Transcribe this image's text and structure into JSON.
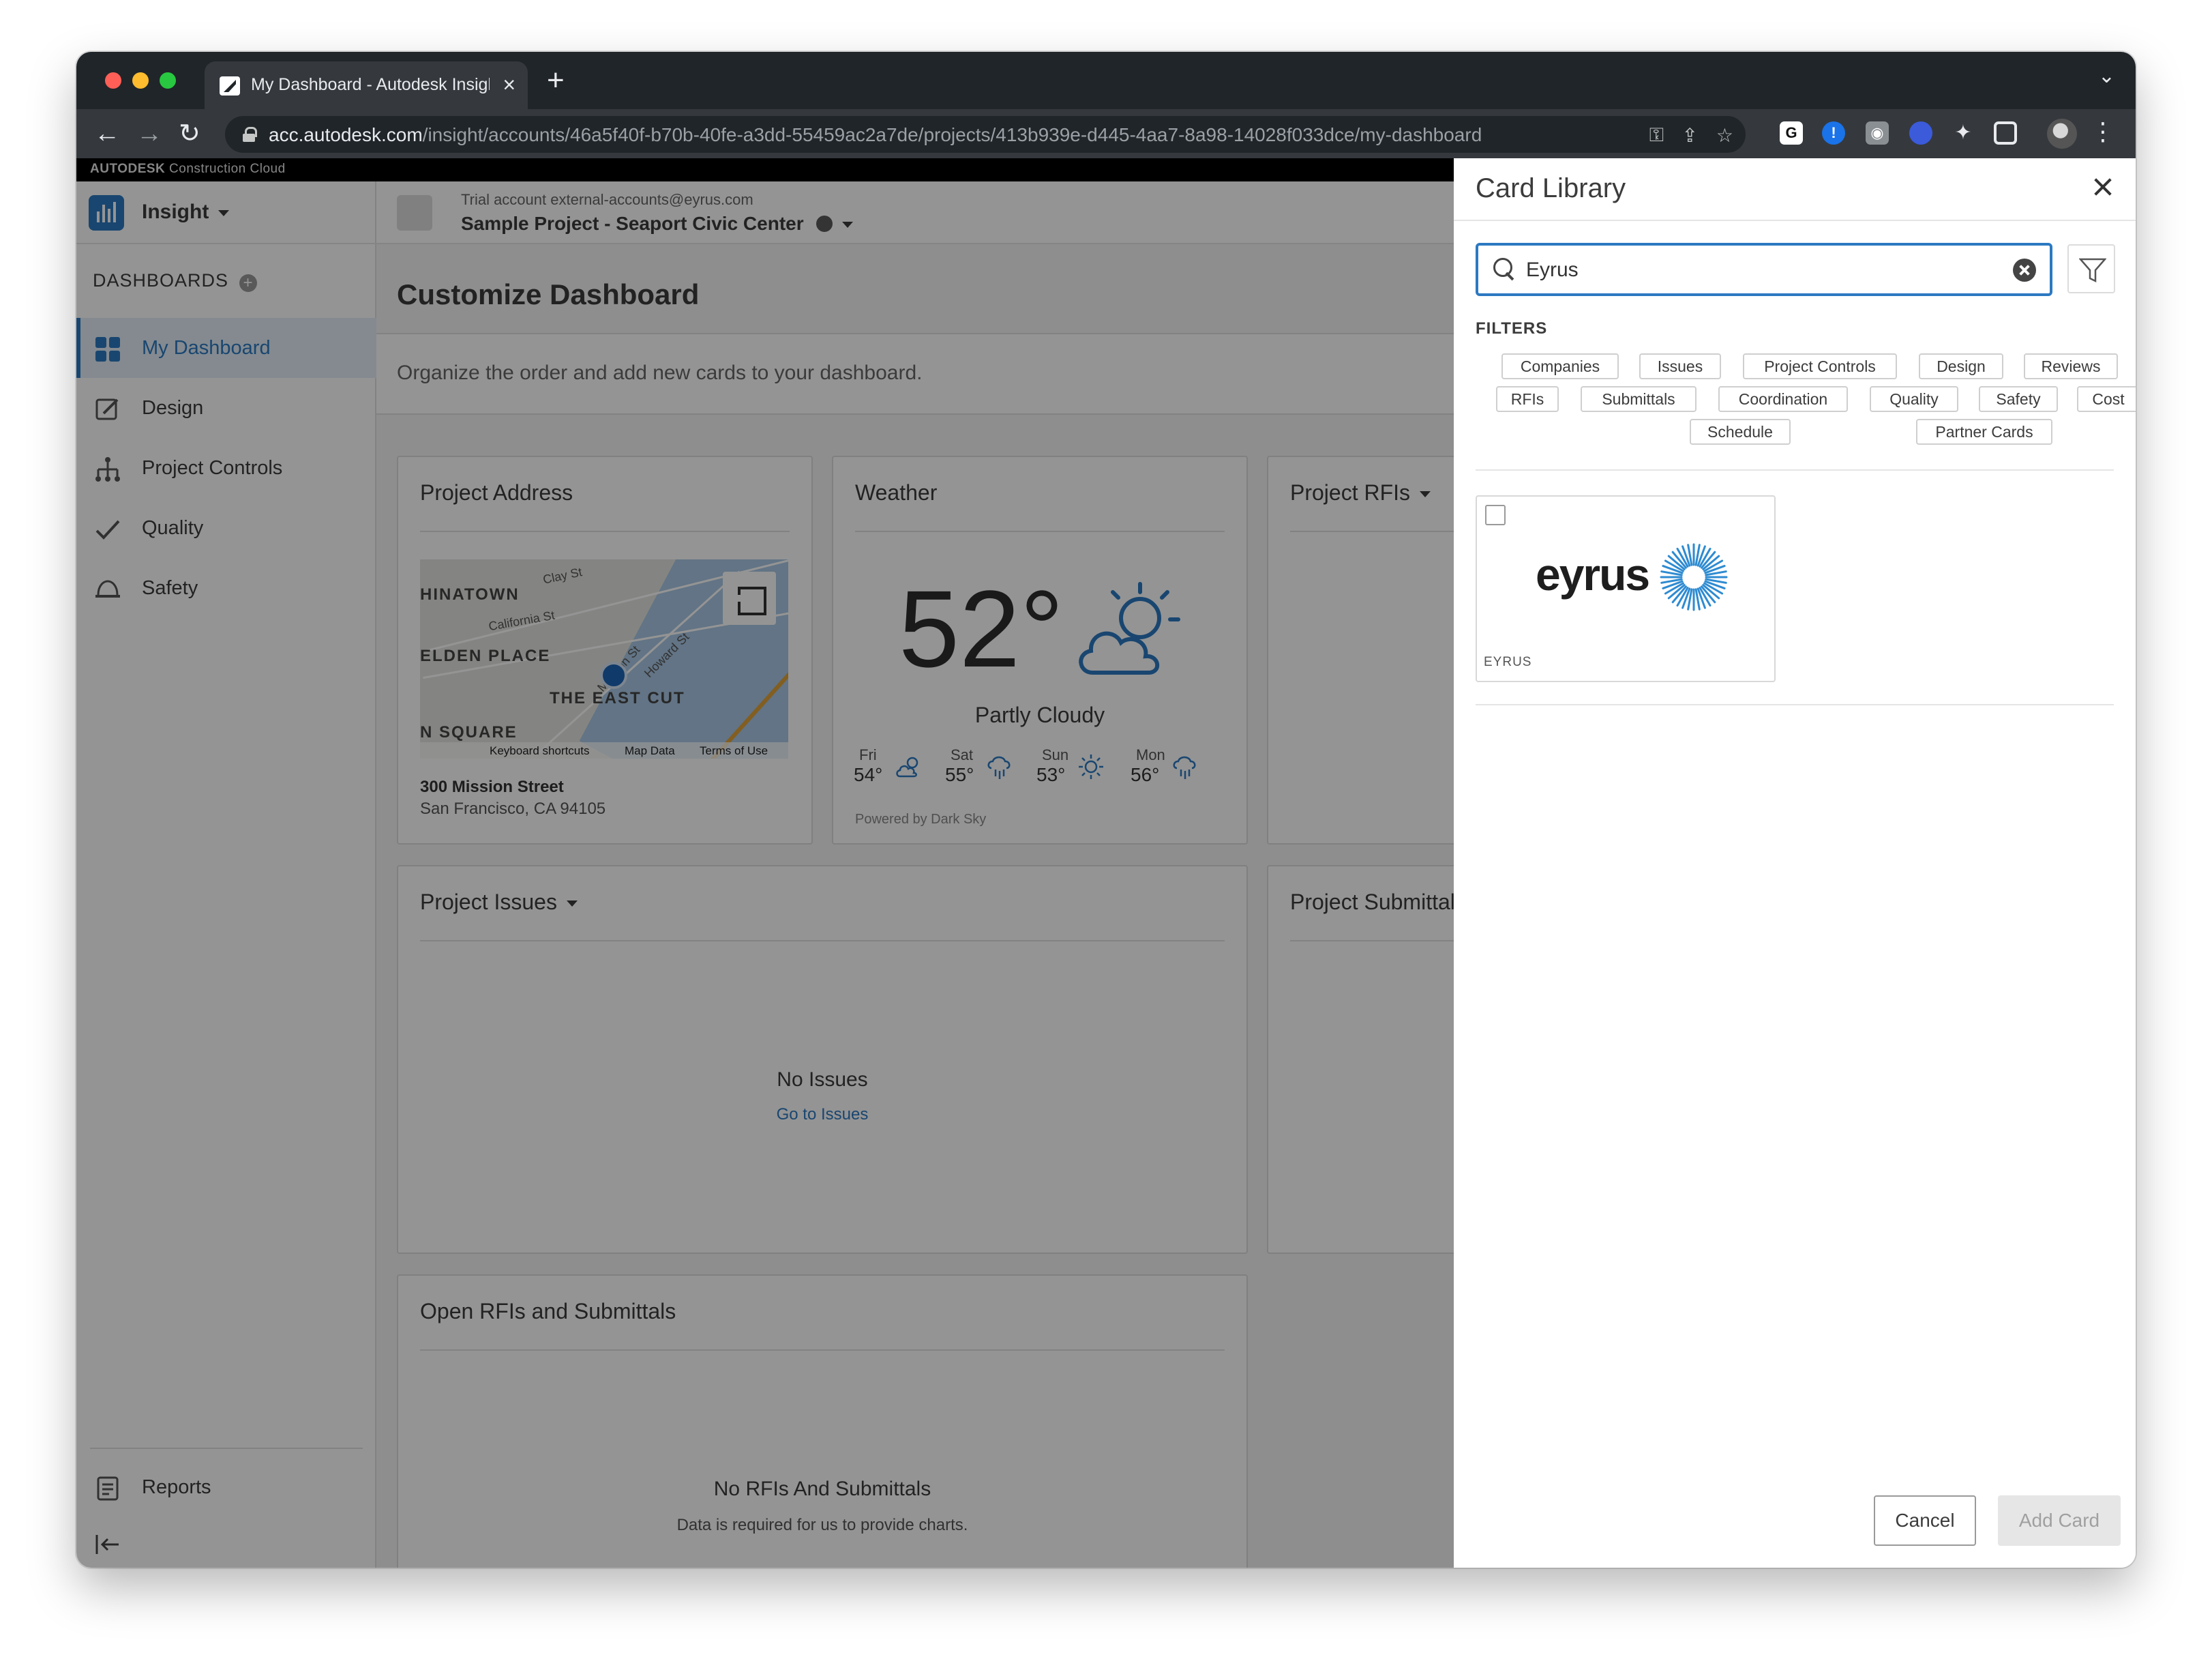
{
  "browser": {
    "tab_title": "My Dashboard - Autodesk Insight",
    "new_tab": "+",
    "url_host": "acc.autodesk.com",
    "url_path": "/insight/accounts/46a5f40f-b70b-40fe-a3dd-55459ac2a7de/projects/413b939e-d445-4aa7-8a98-14028f033dce/my-dashboard"
  },
  "brand": {
    "bold": "AUTODESK",
    "rest": " Construction Cloud"
  },
  "product": {
    "name": "Insight"
  },
  "sidebar": {
    "section_title": "DASHBOARDS",
    "items": [
      {
        "label": "My Dashboard",
        "icon": "grid-icon"
      },
      {
        "label": "Design",
        "icon": "pencil-icon"
      },
      {
        "label": "Project Controls",
        "icon": "hierarchy-icon"
      },
      {
        "label": "Quality",
        "icon": "check-icon"
      },
      {
        "label": "Safety",
        "icon": "hardhat-icon"
      }
    ],
    "reports_label": "Reports",
    "collapse_icon": "collapse-icon"
  },
  "topbar": {
    "trial": "Trial account external-accounts@eyrus.com",
    "project": "Sample Project - Seaport Civic Center"
  },
  "main": {
    "title": "Customize Dashboard",
    "info": "Organize the order and add new cards to your dashboard."
  },
  "cards": {
    "address": {
      "title": "Project Address",
      "line1": "300 Mission Street",
      "line2": "San Francisco, CA 94105",
      "map_labels": [
        "HINATOWN",
        "ELDEN PLACE",
        "THE EAST CUT",
        "N SQUARE"
      ],
      "map_streets": [
        "Clay St",
        "California St",
        "Mission St",
        "Howard St"
      ],
      "map_footer": [
        "Keyboard shortcuts",
        "Map Data",
        "Terms of Use"
      ]
    },
    "weather": {
      "title": "Weather",
      "temp": "52°",
      "condition": "Partly Cloudy",
      "forecast": [
        {
          "day": "Fri",
          "temp": "54°",
          "icon": "partly-cloudy-icon"
        },
        {
          "day": "Sat",
          "temp": "55°",
          "icon": "rain-icon"
        },
        {
          "day": "Sun",
          "temp": "53°",
          "icon": "sun-icon"
        },
        {
          "day": "Mon",
          "temp": "56°",
          "icon": "rain-icon"
        }
      ],
      "powered": "Powered by Dark Sky"
    },
    "rfis": {
      "title": "Project RFIs"
    },
    "issues": {
      "title": "Project Issues",
      "empty": "No Issues",
      "link": "Go to Issues"
    },
    "submittals": {
      "title": "Project Submittals"
    },
    "open_rfis": {
      "title": "Open RFIs and Submittals",
      "empty": "No RFIs And Submittals",
      "sub": "Data is required for us to provide charts."
    }
  },
  "panel": {
    "title": "Card Library",
    "search_value": "Eyrus",
    "filters_label": "FILTERS",
    "chips": [
      "Companies",
      "Issues",
      "Project Controls",
      "Design",
      "Reviews",
      "RFIs",
      "Submittals",
      "Coordination",
      "Quality",
      "Safety",
      "Cost",
      "Schedule",
      "Partner Cards"
    ],
    "partner": {
      "logo_text": "eyrus",
      "name": "EYRUS"
    },
    "cancel": "Cancel",
    "add": "Add Card"
  },
  "colors": {
    "accent": "#2c79c2",
    "eyrus_blue": "#2e8bd1"
  }
}
